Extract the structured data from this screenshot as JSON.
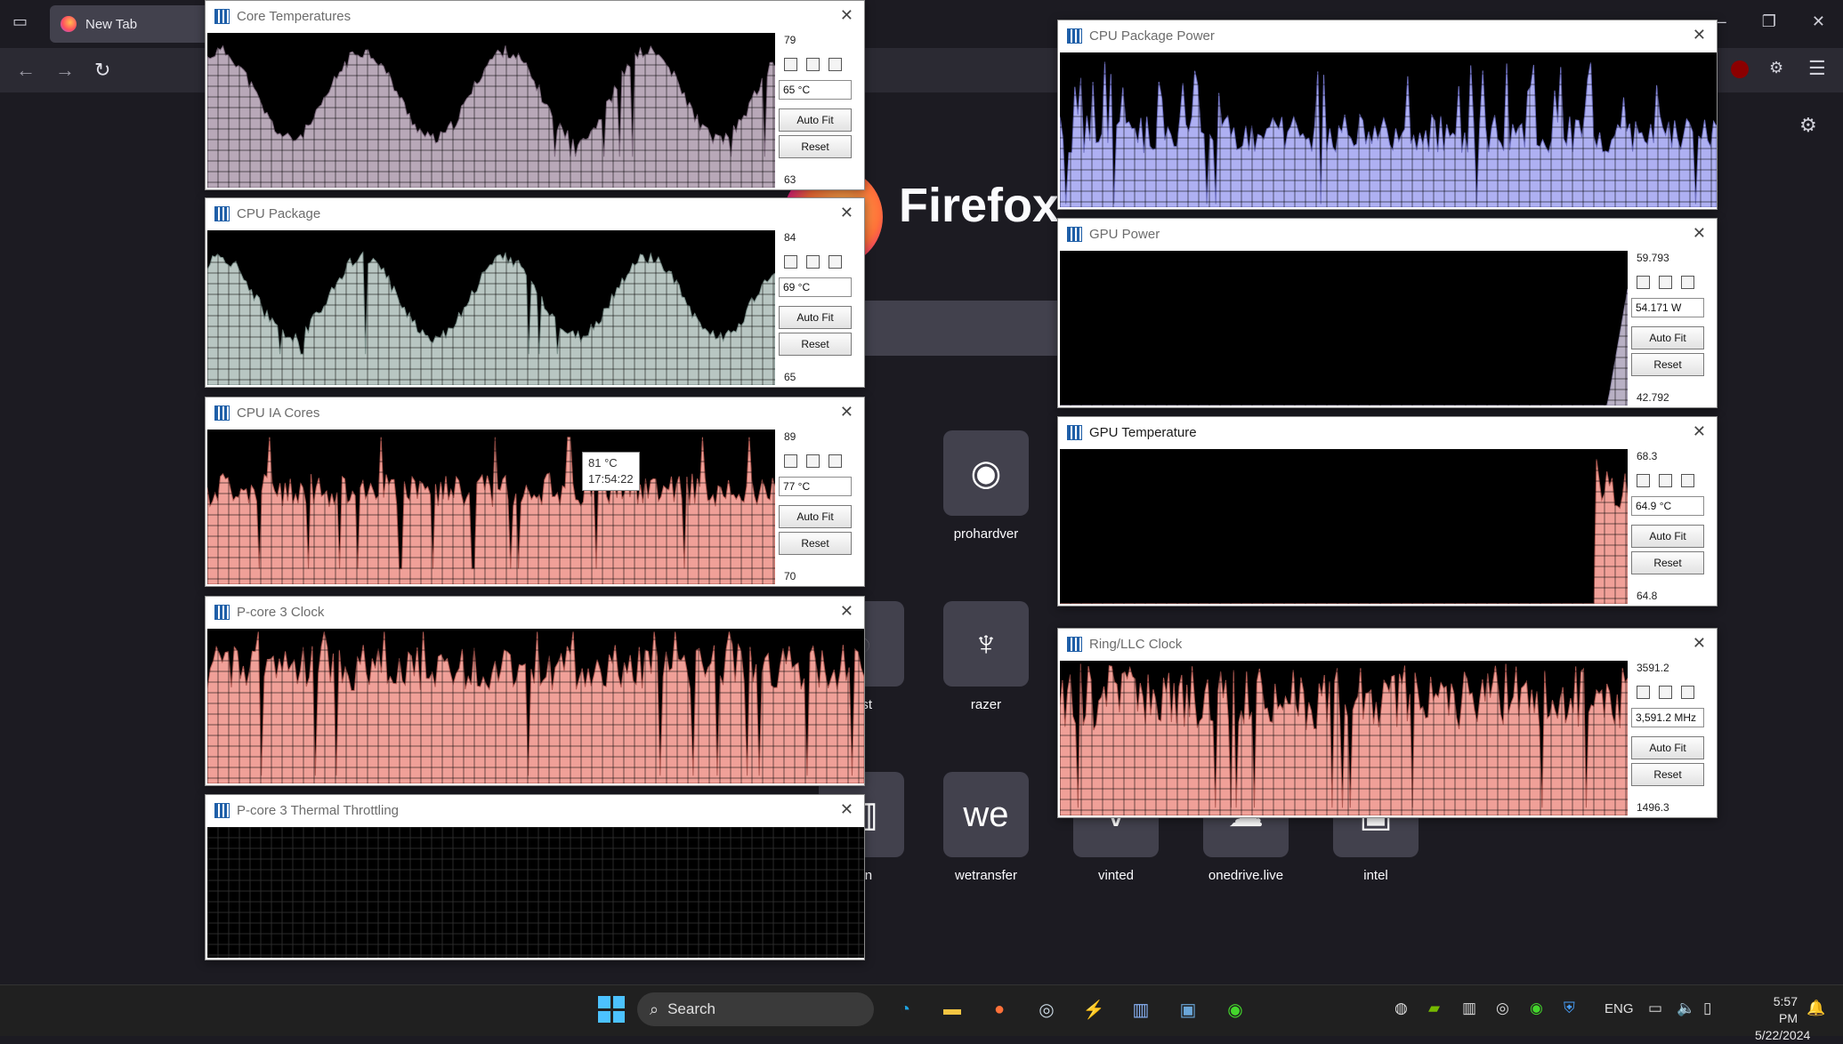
{
  "browser": {
    "tab_title": "New Tab",
    "wordmark": "Firefox",
    "shortcuts": [
      {
        "label": "prohardver",
        "glyph": "◉"
      },
      {
        "label": "razer",
        "glyph": "♆"
      },
      {
        "label": "wetransfer",
        "glyph": "we"
      },
      {
        "label": "test",
        "glyph": "◐"
      },
      {
        "label": "ven",
        "glyph": "▥"
      },
      {
        "label": "vinted",
        "glyph": "v"
      },
      {
        "label": "onedrive.live",
        "glyph": "☁"
      },
      {
        "label": "intel",
        "glyph": "▣"
      }
    ]
  },
  "graphs": [
    {
      "id": "core-temperatures",
      "title": "Core Temperatures",
      "max": "79",
      "current": "65 °C",
      "min": "63",
      "has_side": true,
      "fill": "#b8a8b8",
      "stroke": "#7e6a7e",
      "profile": "wave",
      "level_low": 0.25,
      "level_high": 0.88
    },
    {
      "id": "cpu-package",
      "title": "CPU Package",
      "max": "84",
      "current": "69 °C",
      "min": "65",
      "has_side": true,
      "fill": "#b8c6c2",
      "stroke": "#7a8f8a",
      "profile": "wave",
      "level_low": 0.25,
      "level_high": 0.82
    },
    {
      "id": "cpu-ia-cores",
      "title": "CPU IA Cores",
      "max": "89",
      "current": "77 °C",
      "min": "70",
      "has_side": true,
      "fill": "#f0a098",
      "stroke": "#b05a52",
      "profile": "noisy",
      "level_low": 0.5,
      "level_high": 0.72
    },
    {
      "id": "p-core-3-clock",
      "title": "P-core 3 Clock",
      "has_side": false,
      "fill": "#f0a098",
      "stroke": "#b05a52",
      "profile": "clock",
      "level_low": 0.6,
      "level_high": 0.9
    },
    {
      "id": "p-core-3-thermal-throttling",
      "title": "P-core 3 Thermal Throttling",
      "has_side": false,
      "fill": "#f0a098",
      "stroke": "#b05a52",
      "profile": "empty",
      "level_low": 0,
      "level_high": 0
    },
    {
      "id": "cpu-package-power",
      "title": "CPU Package Power",
      "has_side": false,
      "fill": "#aeb0f2",
      "stroke": "#6e70c0",
      "profile": "power",
      "level_low": 0.35,
      "level_high": 0.95
    },
    {
      "id": "gpu-power",
      "title": "GPU Power",
      "max": "59.793",
      "current": "54.171 W",
      "min": "42.792",
      "has_side": true,
      "fill": "#b8b0c4",
      "stroke": "#8a82a0",
      "profile": "spike-end",
      "level_low": 0,
      "level_high": 0.85
    },
    {
      "id": "gpu-temperature",
      "title": "GPU Temperature",
      "max": "68.3",
      "current": "64.9 °C",
      "min": "64.8",
      "has_side": true,
      "fill": "#f0a098",
      "stroke": "#b05a52",
      "profile": "spike-end-sharp",
      "level_low": 0,
      "level_high": 0.98
    },
    {
      "id": "ring-llc-clock",
      "title": "Ring/LLC Clock",
      "max": "3591.2",
      "current": "3,591.2 MHz",
      "min": "1496.3",
      "has_side": true,
      "fill": "#f0a098",
      "stroke": "#b05a52",
      "profile": "clock",
      "level_low": 0.55,
      "level_high": 0.97
    }
  ],
  "buttons": {
    "auto_fit": "Auto Fit",
    "reset": "Reset"
  },
  "tooltip": {
    "line1": "81 °C",
    "line2": "17:54:22"
  },
  "taskbar": {
    "search_label": "Search",
    "language": "ENG",
    "time": "5:57 PM",
    "date": "5/22/2024",
    "apps": [
      "edge-icon",
      "file-explorer-icon",
      "firefox-icon",
      "steam-icon",
      "app-icon",
      "hwinfo-icon",
      "monitor-app-icon",
      "razer-icon"
    ]
  }
}
